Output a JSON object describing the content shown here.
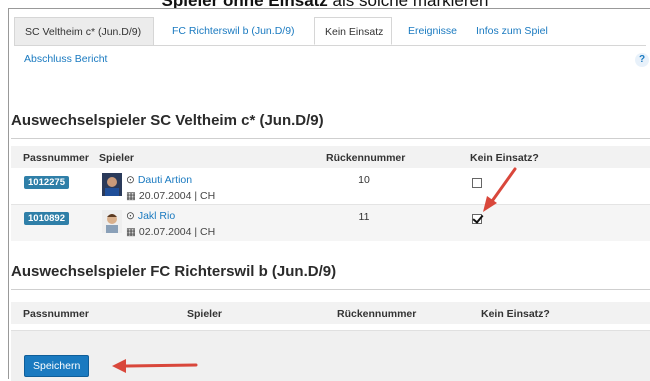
{
  "caption": {
    "bold_text": "Spieler ohne Einsatz",
    "rest_text": " als solche markieren"
  },
  "tabs": [
    {
      "label": "SC Veltheim c* (Jun.D/9)"
    },
    {
      "label": "FC Richterswil b (Jun.D/9)"
    },
    {
      "label": "Kein Einsatz"
    },
    {
      "label": "Ereignisse"
    },
    {
      "label": "Infos zum Spiel"
    },
    {
      "label": "Abschluss Bericht"
    }
  ],
  "help_label": "?",
  "section1": {
    "title": "Auswechselspieler SC Veltheim c* (Jun.D/9)",
    "headers": {
      "passnummer": "Passnummer",
      "spieler": "Spieler",
      "rueckennummer": "Rückennummer",
      "kein_einsatz": "Kein Einsatz?"
    },
    "rows": [
      {
        "passnummer": "1012275",
        "name": "Dauti Artion",
        "date": "20.07.2004 | CH",
        "number": "10",
        "kein_einsatz": false
      },
      {
        "passnummer": "1010892",
        "name": "Jakl Rio",
        "date": "02.07.2004 | CH",
        "number": "11",
        "kein_einsatz": true
      }
    ]
  },
  "section2": {
    "title": "Auswechselspieler FC Richterswil b (Jun.D/9)",
    "headers": {
      "passnummer": "Passnummer",
      "spieler": "Spieler",
      "rueckennummer": "Rückennummer",
      "kein_einsatz": "Kein Einsatz?"
    }
  },
  "save_button": "Speichern",
  "colors": {
    "link": "#1a7ac0",
    "badge": "#2f7fa8",
    "arrow": "#d9473b",
    "button": "#1a7ac0"
  }
}
